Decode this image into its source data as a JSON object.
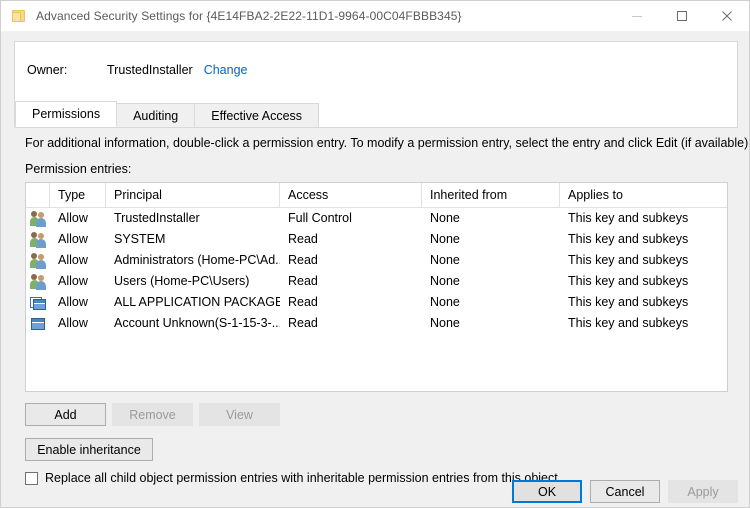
{
  "window": {
    "title": "Advanced Security Settings for {4E14FBA2-2E22-11D1-9964-00C04FBBB345}",
    "icon": "folder-icon",
    "caption_buttons": {
      "minimize": "minimize-icon",
      "maximize": "maximize-icon",
      "close": "close-icon"
    }
  },
  "owner": {
    "label": "Owner:",
    "value": "TrustedInstaller",
    "change_link": "Change"
  },
  "tabs": [
    {
      "label": "Permissions",
      "active": true
    },
    {
      "label": "Auditing",
      "active": false
    },
    {
      "label": "Effective Access",
      "active": false
    }
  ],
  "body": {
    "info_text": "For additional information, double-click a permission entry. To modify a permission entry, select the entry and click Edit (if available).",
    "entries_label": "Permission entries:"
  },
  "table": {
    "columns": [
      "",
      "Type",
      "Principal",
      "Access",
      "Inherited from",
      "Applies to"
    ],
    "rows": [
      {
        "icon": "user-group-icon",
        "type": "Allow",
        "principal": "TrustedInstaller",
        "access": "Full Control",
        "inherited_from": "None",
        "applies_to": "This key and subkeys"
      },
      {
        "icon": "user-group-icon",
        "type": "Allow",
        "principal": "SYSTEM",
        "access": "Read",
        "inherited_from": "None",
        "applies_to": "This key and subkeys"
      },
      {
        "icon": "user-group-icon",
        "type": "Allow",
        "principal": "Administrators (Home-PC\\Ad...",
        "access": "Read",
        "inherited_from": "None",
        "applies_to": "This key and subkeys"
      },
      {
        "icon": "user-group-icon",
        "type": "Allow",
        "principal": "Users (Home-PC\\Users)",
        "access": "Read",
        "inherited_from": "None",
        "applies_to": "This key and subkeys"
      },
      {
        "icon": "app-package-icon",
        "type": "Allow",
        "principal": "ALL APPLICATION PACKAGES",
        "access": "Read",
        "inherited_from": "None",
        "applies_to": "This key and subkeys"
      },
      {
        "icon": "app-package-icon-alt",
        "type": "Allow",
        "principal": "Account Unknown(S-1-15-3-...",
        "access": "Read",
        "inherited_from": "None",
        "applies_to": "This key and subkeys"
      }
    ]
  },
  "actions": {
    "add": "Add",
    "remove": "Remove",
    "view": "View",
    "enable_inheritance": "Enable inheritance"
  },
  "replace_checkbox": {
    "label": "Replace all child object permission entries with inheritable permission entries from this object",
    "checked": false
  },
  "footer": {
    "ok": "OK",
    "cancel": "Cancel",
    "apply": "Apply"
  },
  "colors": {
    "link": "#0066cc",
    "focus_border": "#0078d7",
    "window_bg": "#f0f0f0",
    "panel_bg": "#ffffff",
    "disabled_text": "#9a9a9a"
  }
}
